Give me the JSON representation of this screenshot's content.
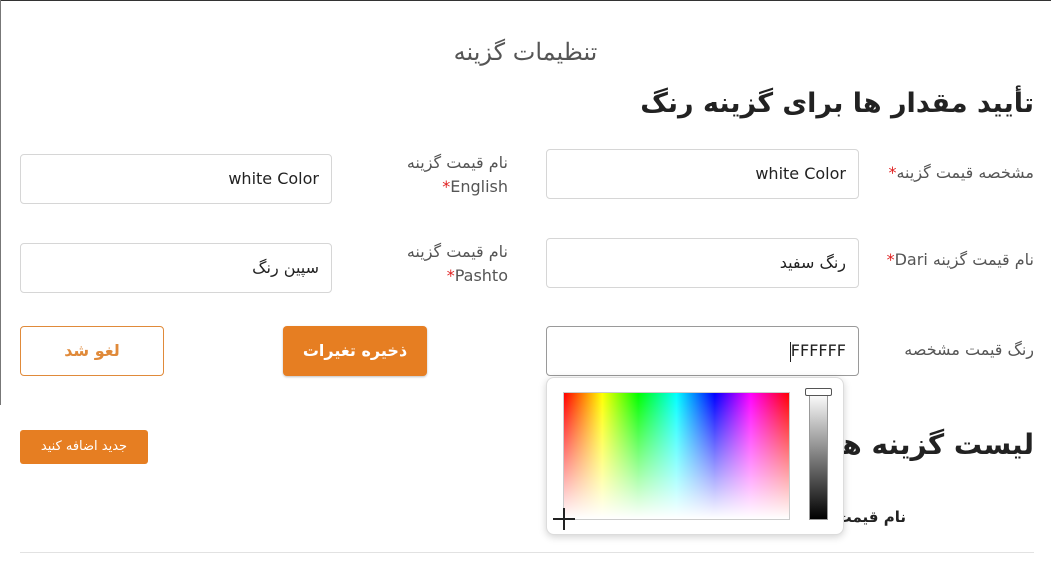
{
  "page": {
    "title": "تنظیمات گزینه"
  },
  "form": {
    "section_title": "تأیید مقدار ها برای گزینه رنگ",
    "option_value_id": {
      "label": "مشخصه قیمت گزینه",
      "required_mark": "*",
      "value": "white Color"
    },
    "option_value_name_english": {
      "label_line1": "نام قیمت گزینه",
      "label_line2": "English",
      "required_mark": "*",
      "value": "white Color"
    },
    "option_value_name_dari": {
      "label": "نام قیمت گزینه Dari",
      "required_mark": "*",
      "value": "رنگ سفید"
    },
    "option_value_name_pashto": {
      "label_line1": "نام قیمت گزینه",
      "label_line2": "Pashto",
      "required_mark": "*",
      "value": "سپین رنگ"
    },
    "option_value_color": {
      "label": "رنگ قیمت مشخصه",
      "value": "FFFFFF"
    },
    "save_label": "ذخیره تغیرات",
    "cancel_label": "لغو شد"
  },
  "color_picker": {
    "selected_color": "#FFFFFF",
    "lightness": 1.0
  },
  "list": {
    "add_label": "جدید اضافه کنید",
    "title": "لیست گزینه ها",
    "column_header": "نام قیمت"
  },
  "colors": {
    "accent": "#e67e22",
    "required": "#e02020"
  }
}
